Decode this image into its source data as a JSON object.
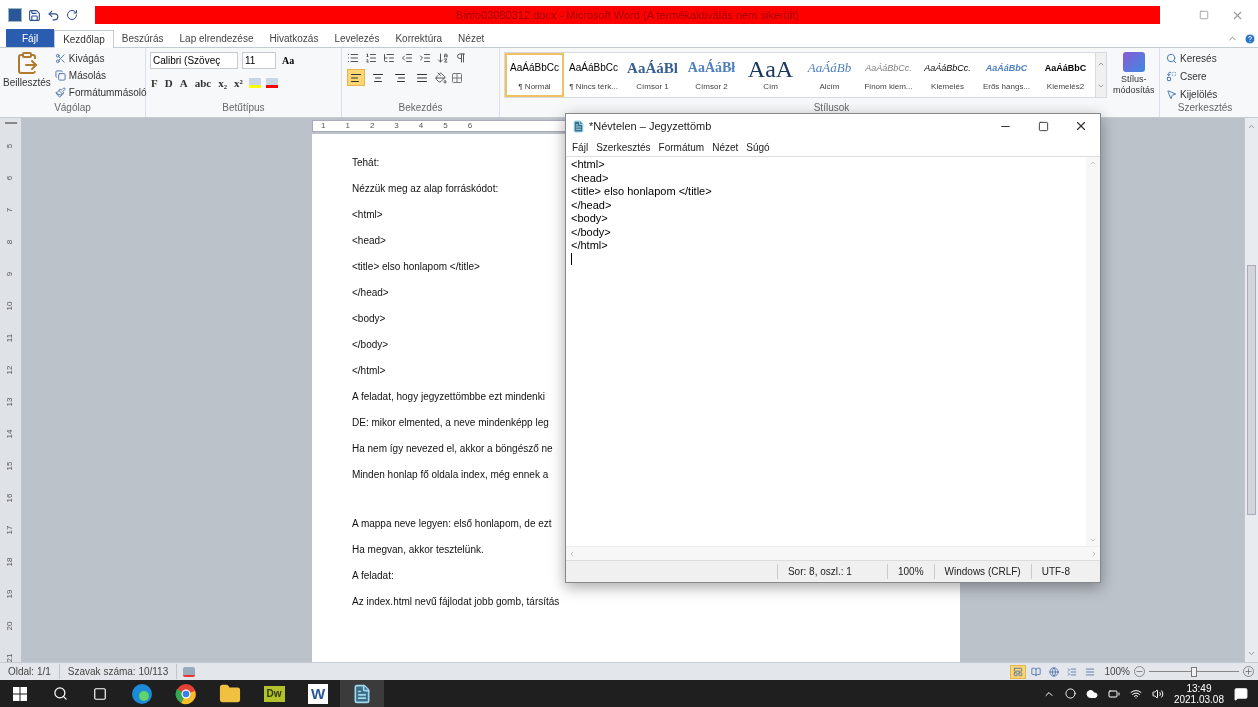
{
  "word": {
    "title": "Binfo03080312.docx - Microsoft Word (A termékaktiválás nem sikerült)",
    "tabs": [
      {
        "label": "Fájl",
        "selected": false,
        "kind": "file"
      },
      {
        "label": "Kezdőlap",
        "selected": true,
        "kind": "tab"
      },
      {
        "label": "Beszúrás",
        "selected": false,
        "kind": "tab"
      },
      {
        "label": "Lap elrendezése",
        "selected": false,
        "kind": "tab"
      },
      {
        "label": "Hivatkozás",
        "selected": false,
        "kind": "tab"
      },
      {
        "label": "Levelezés",
        "selected": false,
        "kind": "tab"
      },
      {
        "label": "Korrektúra",
        "selected": false,
        "kind": "tab"
      },
      {
        "label": "Nézet",
        "selected": false,
        "kind": "tab"
      }
    ],
    "clipboard": {
      "paste": "Beillesztés",
      "items": [
        {
          "kind": "cut",
          "label": "Kivágás"
        },
        {
          "kind": "copy",
          "label": "Másolás"
        },
        {
          "kind": "painter",
          "label": "Formátummásoló"
        }
      ],
      "label": "Vágólap"
    },
    "font": {
      "family": "Calibri (Szöveç",
      "size": "11",
      "case_button": "Aa",
      "format_buttons": [
        "F",
        "D",
        "A",
        "abc",
        "x₂",
        "x²"
      ],
      "label": "Betűtípus"
    },
    "paragraph": {
      "alignments": [
        {
          "kind": "left",
          "selected": true
        },
        {
          "kind": "center",
          "selected": false
        },
        {
          "kind": "right",
          "selected": false
        },
        {
          "kind": "justify",
          "selected": false
        }
      ],
      "label": "Bekezdés"
    },
    "styles": {
      "items": [
        {
          "preview": "AaÁáBbCc",
          "label": "¶ Normál",
          "kind": "normal",
          "selected": true
        },
        {
          "preview": "AaÁáBbCc",
          "label": "¶ Nincs térk...",
          "kind": "normal",
          "selected": false
        },
        {
          "preview": "AaÁáBl",
          "label": "Címsor 1",
          "kind": "heading1",
          "selected": false
        },
        {
          "preview": "AaÁáBł",
          "label": "Címsor 2",
          "kind": "heading2",
          "selected": false
        },
        {
          "preview": "AaA",
          "label": "Cím",
          "kind": "title",
          "selected": false
        },
        {
          "preview": "AaÁáBb",
          "label": "Alcím",
          "kind": "subtitle",
          "selected": false
        },
        {
          "preview": "AaÁáBbCc.",
          "label": "Finom kiem...",
          "kind": "subtle",
          "selected": false
        },
        {
          "preview": "AaÁáBbCc.",
          "label": "Kiemelés",
          "kind": "emphasis",
          "selected": false
        },
        {
          "preview": "AaÁáBbC",
          "label": "Erős hangs...",
          "kind": "intense",
          "selected": false
        },
        {
          "preview": "AaÁáBbC",
          "label": "Kiemelés2",
          "kind": "strong",
          "selected": false
        }
      ],
      "change": "Stílus-módosítás",
      "label": "Stílusok"
    },
    "editing": {
      "items": [
        {
          "kind": "find",
          "label": "Keresés"
        },
        {
          "kind": "replace",
          "label": "Csere"
        },
        {
          "kind": "select",
          "label": "Kijelölés"
        }
      ],
      "label": "Szerkesztés"
    },
    "ruler": [
      "1",
      "1",
      "2",
      "3",
      "4",
      "5",
      "6"
    ],
    "vertical_ruler": [
      "5",
      "6",
      "7",
      "8",
      "9",
      "10",
      "11",
      "12",
      "13",
      "14",
      "15",
      "16",
      "17",
      "18",
      "19",
      "20",
      "21"
    ],
    "document": {
      "sections": [
        [
          "Tehát:",
          "Nézzük meg az alap forráskódot:",
          "<html>",
          "<head>",
          "<title> elso honlapom </title>",
          "</head>",
          "<body>",
          "</body>",
          "</html>",
          "A feladat, hogy jegyzettömbbe ezt mindenki",
          "DE: mikor elmented, a neve mindenképp leg",
          "Ha nem így nevezed el, akkor a böngésző ne",
          "Minden honlap fő oldala index, még ennek a"
        ],
        [
          "A mappa neve legyen: első honlapom, de ezt",
          "Ha megvan, akkor tesztelünk.",
          "A feladat:",
          "Az index.html nevű fájlodat jobb gomb, társítás"
        ]
      ]
    },
    "status_bar": {
      "page": "Oldal: 1/1",
      "words": "Szavak száma: 10/113",
      "views": [
        {
          "kind": "print",
          "selected": true
        },
        {
          "kind": "read",
          "selected": false
        },
        {
          "kind": "web",
          "selected": false
        },
        {
          "kind": "outline",
          "selected": false
        },
        {
          "kind": "draft",
          "selected": false
        }
      ],
      "zoom": "100%",
      "level": 0.5
    }
  },
  "notepad": {
    "title": "*Névtelen – Jegyzettömb",
    "menu": [
      "Fájl",
      "Szerkesztés",
      "Formátum",
      "Nézet",
      "Súgó"
    ],
    "lines": [
      "<html>",
      "<head>",
      "<title> elso honlapom </title>",
      "</head>",
      "<body>",
      "</body>",
      "</html>"
    ],
    "status": [
      "Sor: 8, oszl.: 1",
      "100%",
      "Windows (CRLF)",
      "UTF-8"
    ]
  },
  "taskbar": {
    "apps": [
      {
        "kind": "edge",
        "active": false
      },
      {
        "kind": "chrome",
        "active": false
      },
      {
        "kind": "explorer",
        "active": false
      },
      {
        "kind": "dreamweaver",
        "label": "Dw",
        "active": false
      },
      {
        "kind": "word",
        "label": "W",
        "active": false
      },
      {
        "kind": "notepad",
        "active": true
      }
    ],
    "time": "13:49",
    "date": "2021.03.08"
  }
}
